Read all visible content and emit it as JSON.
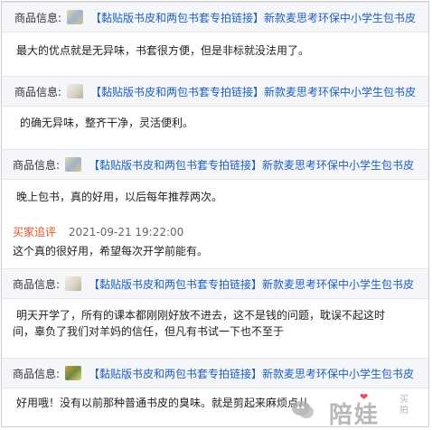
{
  "entries": [
    {
      "product_label": "商品信息:",
      "product_link": "【黏贴版书皮和两包书套专拍链接】新款麦思考环保中小学生包书皮",
      "review_text": "最大的优点就是无异味，书套很方便，但是非标就没法用了。"
    },
    {
      "product_label": "商品信息:",
      "product_link": "【黏贴版书皮和两包书套专拍链接】新款麦思考环保中小学生包书皮",
      "review_text": "的确无异味，整齐干净，灵活便利。"
    },
    {
      "product_label": "商品信息:",
      "product_link": "【黏贴版书皮和两包书套专拍链接】新款麦思考环保中小学生包书皮",
      "review_text": "晚上包书，真的好用，以后每年推荐两次。",
      "followup_label": "买家追评",
      "followup_time": "2021-09-21 19:22:00",
      "followup_text": "这个真的很好用，希望每次开学前能有。"
    },
    {
      "product_label": "商品信息:",
      "product_link": "【黏贴版书皮和两包书套专拍链接】新款麦思考环保中小学生包书皮",
      "review_text_line1": "明天开学了，所有的课本都刚刚好放不进去，这不是钱的问题，耽误不起这时",
      "review_text_line2": "间，辜负了我们对羊妈的信任，但凡有书试一下也不至于"
    },
    {
      "product_label": "商品信息:",
      "product_link": "【黏贴版书皮和两包书套专拍链接】新款麦思考环保中小学生包书皮",
      "review_text": "好用哦！没有以前那种普通书皮的臭味。就是剪起来麻烦点儿"
    }
  ],
  "watermark": {
    "brand": "陪娃",
    "side": "买拍"
  }
}
